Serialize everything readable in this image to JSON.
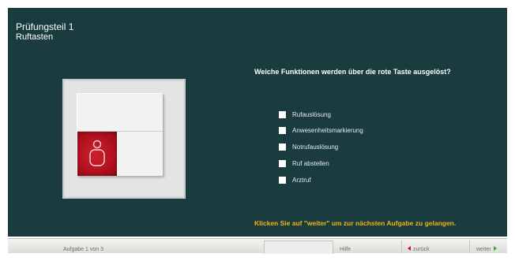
{
  "header": {
    "title": "Prüfungsteil 1",
    "subtitle": "Ruftasten"
  },
  "question": "Weiche Funktionen werden über die rote Taste ausgelöst?",
  "options": [
    {
      "label": "Rufauslösung",
      "checked": false
    },
    {
      "label": "Anwesenheitsmarkierung",
      "checked": false
    },
    {
      "label": "Notrufauslösung",
      "checked": false
    },
    {
      "label": "Ruf abstellen",
      "checked": false
    },
    {
      "label": "Arztruf",
      "checked": false
    }
  ],
  "hint": "Klicken Sie auf \"weiter\" um zur nächsten Aufgabe zu gelangen.",
  "footer": {
    "status": "Aufgabe 1 von 3",
    "help": "Hilfe",
    "back": "zurück",
    "next": "weiter"
  },
  "colors": {
    "background": "#1b3c3f",
    "hint": "#f2b418",
    "button_red": "#c8102e",
    "next_arrow": "#3aa335"
  },
  "icons": {
    "switch": "call-switch-icon",
    "person": "person-icon",
    "back": "arrow-left-icon",
    "next": "arrow-right-icon"
  }
}
